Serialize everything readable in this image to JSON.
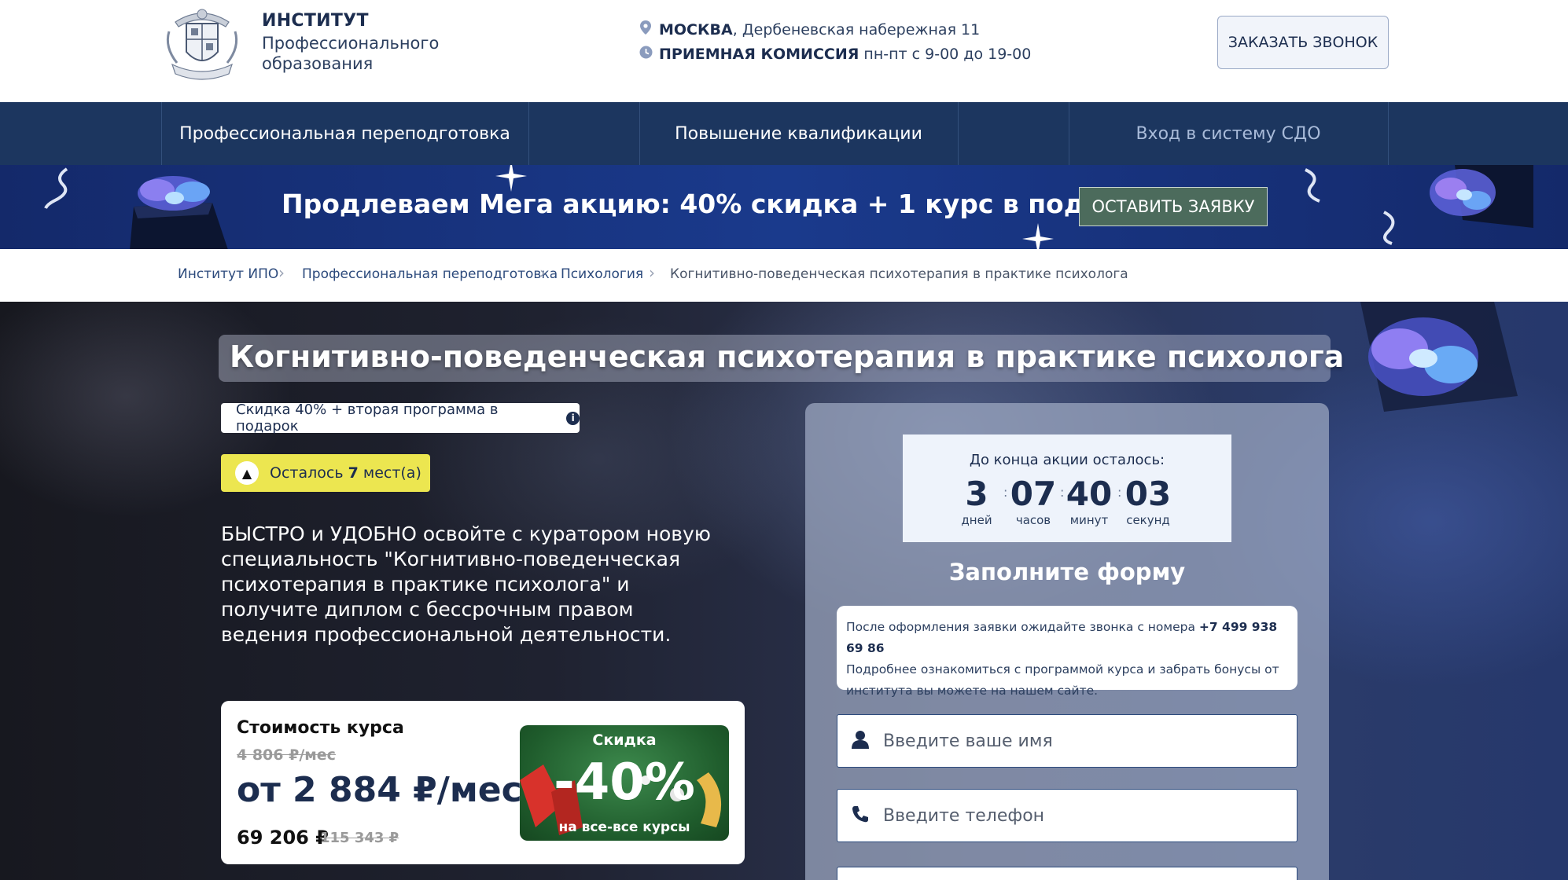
{
  "header": {
    "logo_title": "ИНСТИТУТ",
    "logo_subtitle": "Профессионального образования",
    "address_city": "МОСКВА",
    "address_rest": ", Дербеневская набережная 11",
    "hours_label": "ПРИЕМНАЯ КОМИССИЯ",
    "hours_value": " пн-пт с 9-00 до 19-00",
    "call_button": "ЗАКАЗАТЬ ЗВОНОК"
  },
  "nav": {
    "items": [
      {
        "label": "Профессиональная переподготовка"
      },
      {
        "label": "Повышение квалификации"
      },
      {
        "label": "Вход в систему СДО"
      }
    ]
  },
  "promo": {
    "text": "Продлеваем Мега акцию: 40% скидка + 1 курс в подарок",
    "button": "ОСТАВИТЬ ЗАЯВКУ"
  },
  "breadcrumb": [
    {
      "label": "Институт ИПО"
    },
    {
      "label": "Профессиональная переподготовка"
    },
    {
      "label": "Психология"
    },
    {
      "label": "Когнитивно-поведенческая психотерапия в практике психолога"
    }
  ],
  "hero": {
    "title": "Когнитивно-поведенческая психотерапия в практике психолога",
    "discount_pill": "Скидка 40% + вторая программа в подарок",
    "seats_prefix": "Осталось ",
    "seats_count": "7",
    "seats_suffix": " мест(а)",
    "description": "БЫСТРО и УДОБНО освойте с куратором новую специальность \"Когнитивно-поведенческая психотерапия в практике психолога\" и получите диплом с бессрочным правом ведения профессиональной деятельности."
  },
  "price": {
    "label": "Стоимость курса",
    "old_monthly": "4 806 ₽/мес",
    "monthly": "от 2 884 ₽/мес",
    "total": "69 206 ₽",
    "total_old": "115 343 ₽",
    "badge_title": "Скидка",
    "badge_value": "-40%",
    "badge_sub": "на все-все курсы"
  },
  "timer": {
    "caption": "До конца акции осталось:",
    "days": "3",
    "days_label": "дней",
    "hours": "07",
    "hours_label": "часов",
    "minutes": "40",
    "minutes_label": "минут",
    "seconds": "03",
    "seconds_label": "секунд"
  },
  "form": {
    "title": "Заполните форму",
    "note_prefix": "После оформления заявки ожидайте звонка с номера ",
    "note_phone": "+7 499 938 69 86",
    "note_rest": "Подробнее ознакомиться с программой курса и забрать бонусы от института вы можете на нашем сайте.",
    "name_placeholder": "Введите ваше имя",
    "phone_placeholder": "Введите телефон"
  },
  "colors": {
    "nav_bg": "#1c365f",
    "promo_bg": "#1a3a8c",
    "promo_button": "#4c6b5c",
    "seats_pill": "#ece650",
    "badge_green": "#1f5c2c",
    "text_dark": "#1c2d4f"
  },
  "icons": [
    "location-pin-icon",
    "clock-icon",
    "info-icon",
    "warning-icon",
    "user-icon",
    "phone-icon",
    "chevron-right-icon"
  ]
}
